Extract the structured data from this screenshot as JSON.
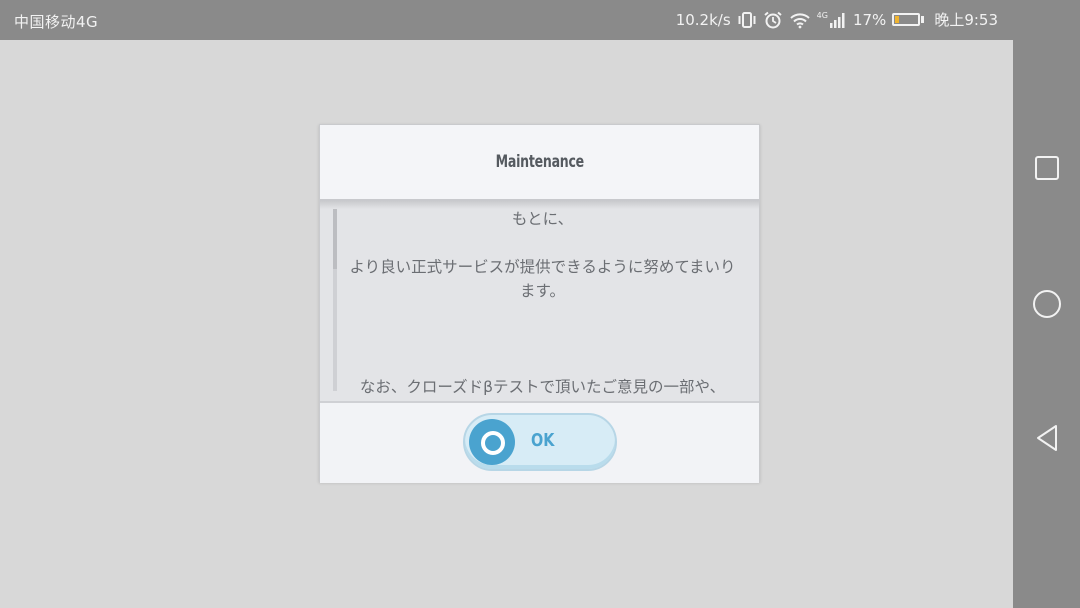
{
  "status_bar": {
    "carrier": "中国移动4G",
    "net_speed": "10.2k/s",
    "network_type": "4G",
    "battery_percent": "17%",
    "battery_level": 0.17,
    "time": "晚上9:53"
  },
  "dialog": {
    "title": "Maintenance",
    "body_text": "もとに、\n\nより良い正式サービスが提供できるように努めてまいります。\n\n\n\nなお、クローズドβテストで頂いたご意見の一部や、",
    "ok_label": "OK"
  },
  "colors": {
    "accent": "#4aa3cf",
    "battery_fill": "#f0b430"
  },
  "icons": [
    "vibrate-icon",
    "alarm-icon",
    "wifi-icon",
    "signal-icon",
    "battery-icon",
    "square-recents-icon",
    "circle-home-icon",
    "triangle-back-icon"
  ]
}
